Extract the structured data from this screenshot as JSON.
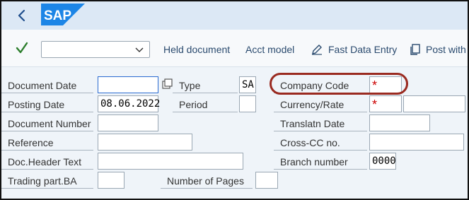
{
  "shell": {
    "back_icon": "chevron-left-icon",
    "logo_text": "SAP",
    "brand_color": "#1c85e6"
  },
  "toolbar": {
    "confirm_icon": "checkmark-icon",
    "variant_value": "",
    "held_document": "Held document",
    "acct_model": "Acct model",
    "fast_data_entry": "Fast Data Entry",
    "post_with": "Post with",
    "fast_data_entry_icon": "pen-icon",
    "post_with_icon": "document-copy-icon"
  },
  "form": {
    "document_date": {
      "label": "Document Date",
      "value": ""
    },
    "type": {
      "label": "Type",
      "value": "SA"
    },
    "company_code": {
      "label": "Company Code",
      "value": "*"
    },
    "posting_date": {
      "label": "Posting Date",
      "value": "08.06.2022"
    },
    "period": {
      "label": "Period",
      "value": ""
    },
    "currency_rate": {
      "label": "Currency/Rate",
      "value": "*",
      "rate_value": ""
    },
    "document_number": {
      "label": "Document Number",
      "value": ""
    },
    "translatn_date": {
      "label": "Translatn Date",
      "value": ""
    },
    "reference": {
      "label": "Reference",
      "value": ""
    },
    "cross_cc": {
      "label": "Cross-CC no.",
      "value": ""
    },
    "doc_header_text": {
      "label": "Doc.Header Text",
      "value": ""
    },
    "branch_number": {
      "label": "Branch number",
      "value": "0000"
    },
    "trading_part": {
      "label": "Trading part.BA",
      "value": ""
    },
    "number_of_pages": {
      "label": "Number of Pages",
      "value": ""
    }
  },
  "colors": {
    "link": "#2a4a6e",
    "required": "#cc0000",
    "highlight": "#9a2a20",
    "check": "#2b7d2b"
  }
}
